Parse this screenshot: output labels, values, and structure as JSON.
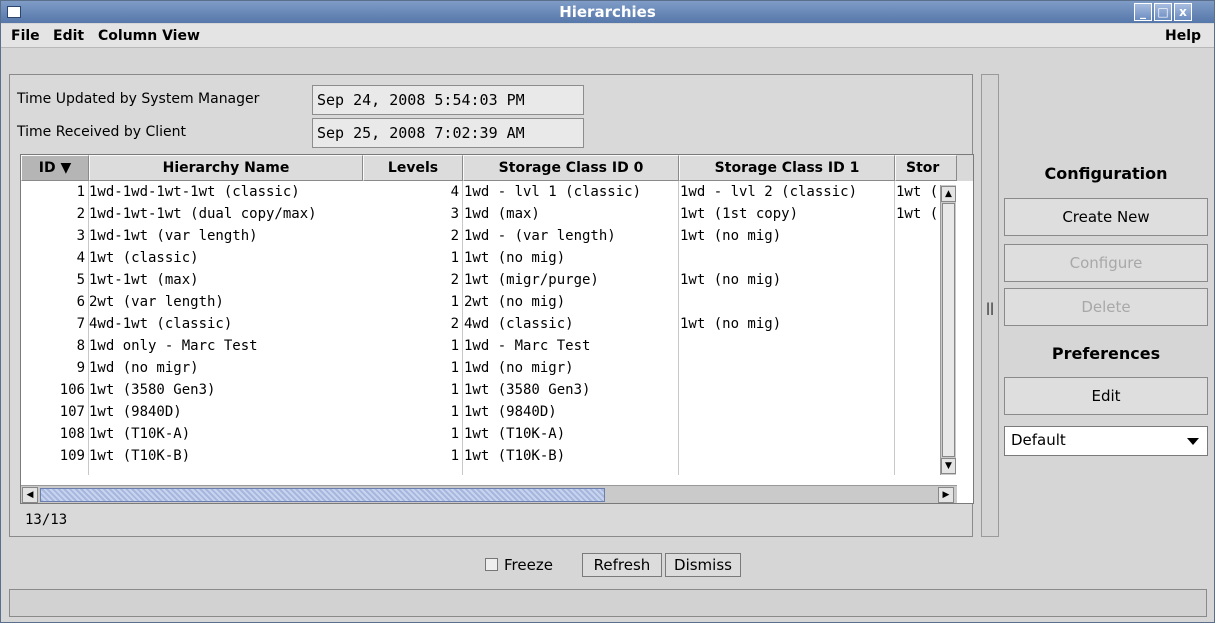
{
  "window": {
    "title": "Hierarchies",
    "title_buttons": [
      "_",
      "□",
      "x"
    ]
  },
  "menu": {
    "file": "File",
    "edit": "Edit",
    "column_view": "Column View",
    "help": "Help"
  },
  "info": {
    "updated_label": "Time Updated by System Manager",
    "updated_value": "Sep 24, 2008 5:54:03 PM",
    "received_label": "Time Received by Client",
    "received_value": "Sep 25, 2008 7:02:39 AM"
  },
  "table": {
    "columns": [
      "ID ▼",
      "Hierarchy Name",
      "Levels",
      "Storage Class ID 0",
      "Storage Class ID 1",
      "Stor"
    ],
    "rows": [
      {
        "id": "1",
        "name": "1wd-1wd-1wt-1wt (classic)",
        "levels": "4",
        "sc0": "1wd - lvl 1 (classic)",
        "sc1": "1wd - lvl 2 (classic)",
        "sc2": "1wt ("
      },
      {
        "id": "2",
        "name": "1wd-1wt-1wt (dual copy/max)",
        "levels": "3",
        "sc0": "1wd (max)",
        "sc1": "1wt (1st copy)",
        "sc2": "1wt ("
      },
      {
        "id": "3",
        "name": "1wd-1wt (var length)",
        "levels": "2",
        "sc0": "1wd - (var length)",
        "sc1": "1wt (no mig)",
        "sc2": ""
      },
      {
        "id": "4",
        "name": "1wt (classic)",
        "levels": "1",
        "sc0": "1wt (no mig)",
        "sc1": "",
        "sc2": ""
      },
      {
        "id": "5",
        "name": "1wt-1wt (max)",
        "levels": "2",
        "sc0": "1wt (migr/purge)",
        "sc1": "1wt (no mig)",
        "sc2": ""
      },
      {
        "id": "6",
        "name": "2wt (var length)",
        "levels": "1",
        "sc0": "2wt (no mig)",
        "sc1": "",
        "sc2": ""
      },
      {
        "id": "7",
        "name": "4wd-1wt (classic)",
        "levels": "2",
        "sc0": "4wd (classic)",
        "sc1": "1wt (no mig)",
        "sc2": ""
      },
      {
        "id": "8",
        "name": "1wd only - Marc Test",
        "levels": "1",
        "sc0": "1wd - Marc Test",
        "sc1": "",
        "sc2": ""
      },
      {
        "id": "9",
        "name": "1wd (no migr)",
        "levels": "1",
        "sc0": "1wd (no migr)",
        "sc1": "",
        "sc2": ""
      },
      {
        "id": "106",
        "name": "1wt (3580 Gen3)",
        "levels": "1",
        "sc0": "1wt (3580 Gen3)",
        "sc1": "",
        "sc2": ""
      },
      {
        "id": "107",
        "name": "1wt (9840D)",
        "levels": "1",
        "sc0": "1wt (9840D)",
        "sc1": "",
        "sc2": ""
      },
      {
        "id": "108",
        "name": "1wt (T10K-A)",
        "levels": "1",
        "sc0": "1wt (T10K-A)",
        "sc1": "",
        "sc2": ""
      },
      {
        "id": "109",
        "name": "1wt (T10K-B)",
        "levels": "1",
        "sc0": "1wt (T10K-B)",
        "sc1": "",
        "sc2": ""
      }
    ],
    "count": "13/13"
  },
  "config": {
    "configuration_label": "Configuration",
    "create_new": "Create New",
    "configure": "Configure",
    "delete": "Delete",
    "preferences_label": "Preferences",
    "edit": "Edit",
    "preference_value": "Default"
  },
  "bottom": {
    "freeze": "Freeze",
    "refresh": "Refresh",
    "dismiss": "Dismiss"
  },
  "colors": {
    "titlebar": "#5577aa",
    "scroll_thumb": "#a6b6dd"
  }
}
